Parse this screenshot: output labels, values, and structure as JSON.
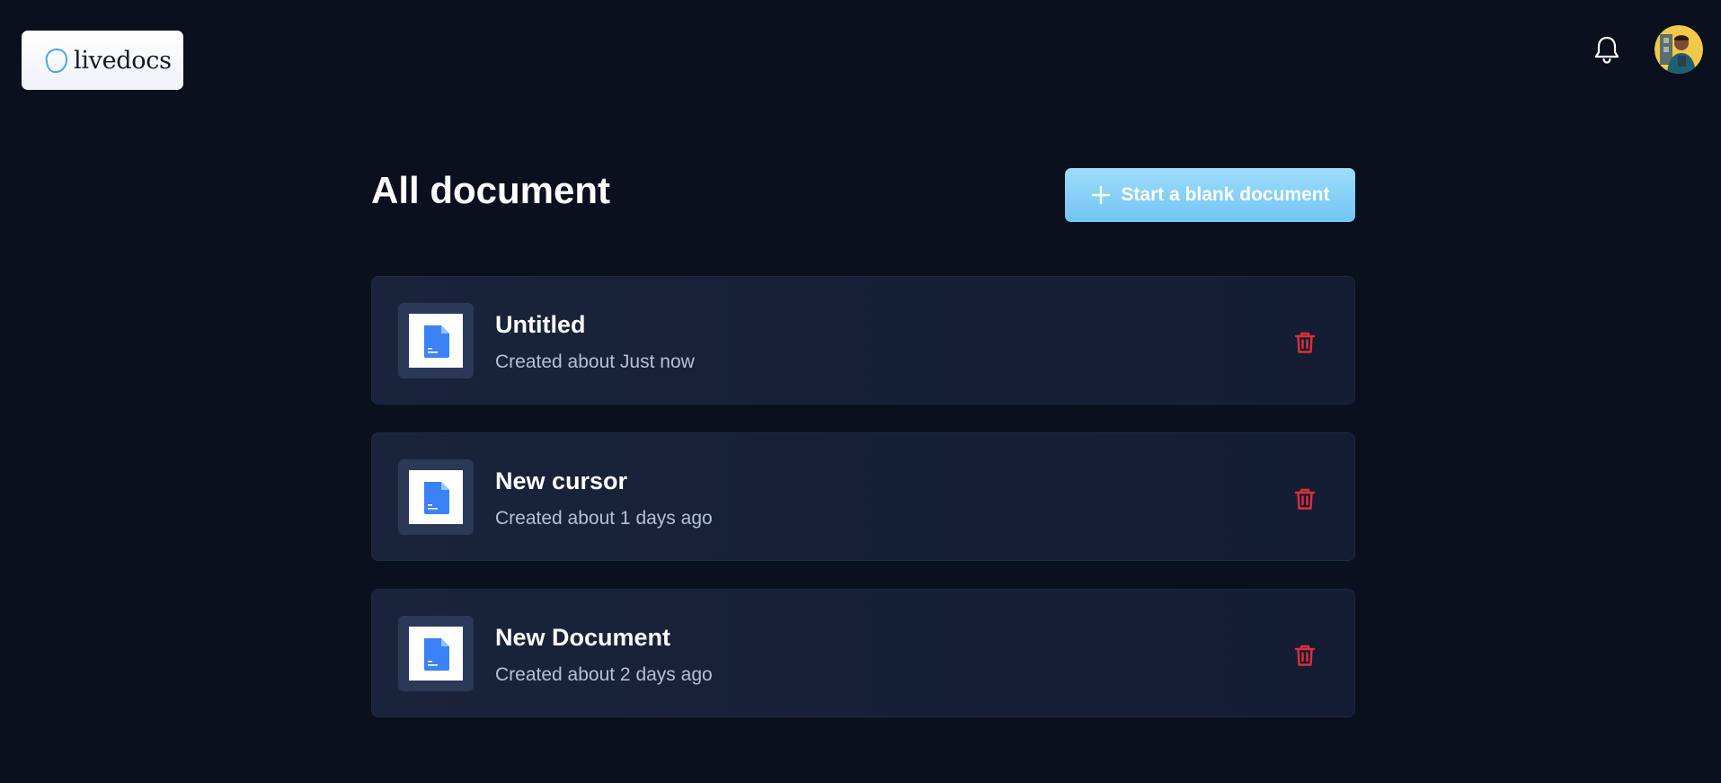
{
  "header": {
    "logo_text": "livedocs",
    "icons": {
      "logo": "livedocs-logo-icon",
      "notifications": "bell-icon",
      "user": "user-avatar"
    }
  },
  "main": {
    "title": "All document",
    "new_button_label": "Start a blank document",
    "documents": [
      {
        "title": "Untitled",
        "meta": "Created about Just now"
      },
      {
        "title": "New cursor",
        "meta": "Created about 1 days ago"
      },
      {
        "title": "New Document",
        "meta": "Created about 2 days ago"
      }
    ]
  },
  "colors": {
    "background": "#0a101d",
    "card": "#19233a",
    "accent": "#8fd3f8",
    "danger": "#dc2f3c",
    "doc_icon": "#3b82f6"
  }
}
